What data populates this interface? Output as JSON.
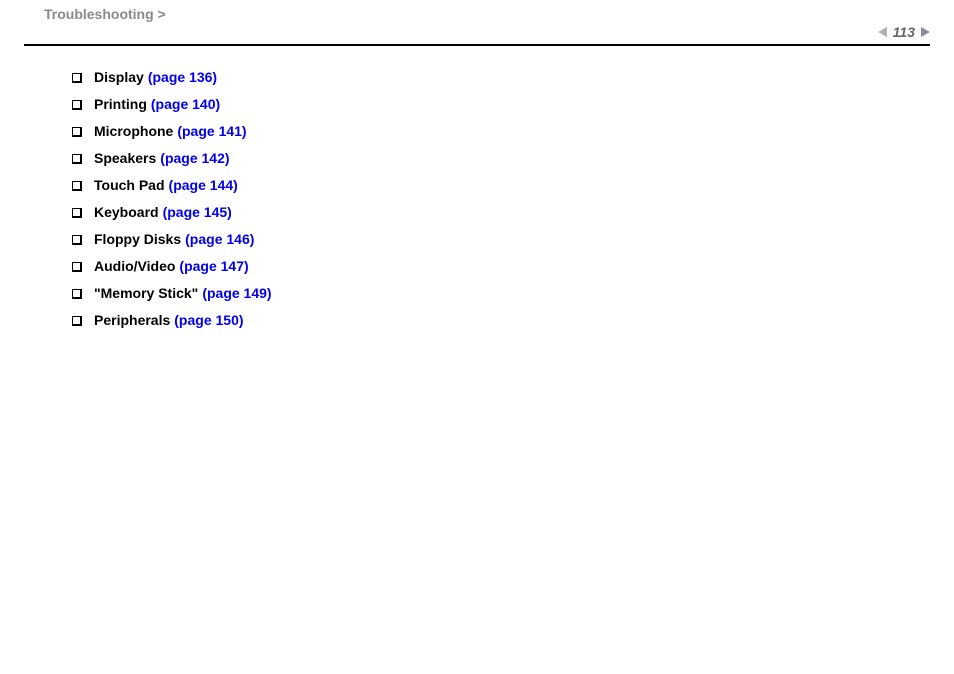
{
  "header": {
    "breadcrumb": "Troubleshooting",
    "chevron": ">",
    "page_number": "113"
  },
  "items": [
    {
      "label": "Display",
      "page_ref": "(page 136)"
    },
    {
      "label": "Printing",
      "page_ref": "(page 140)"
    },
    {
      "label": "Microphone",
      "page_ref": "(page 141)"
    },
    {
      "label": "Speakers",
      "page_ref": "(page 142)"
    },
    {
      "label": "Touch Pad",
      "page_ref": "(page 144)"
    },
    {
      "label": "Keyboard",
      "page_ref": "(page 145)"
    },
    {
      "label": "Floppy Disks",
      "page_ref": "(page 146)"
    },
    {
      "label": "Audio/Video",
      "page_ref": "(page 147)"
    },
    {
      "label": "\"Memory Stick\"",
      "page_ref": "(page 149)"
    },
    {
      "label": "Peripherals",
      "page_ref": "(page 150)"
    }
  ]
}
